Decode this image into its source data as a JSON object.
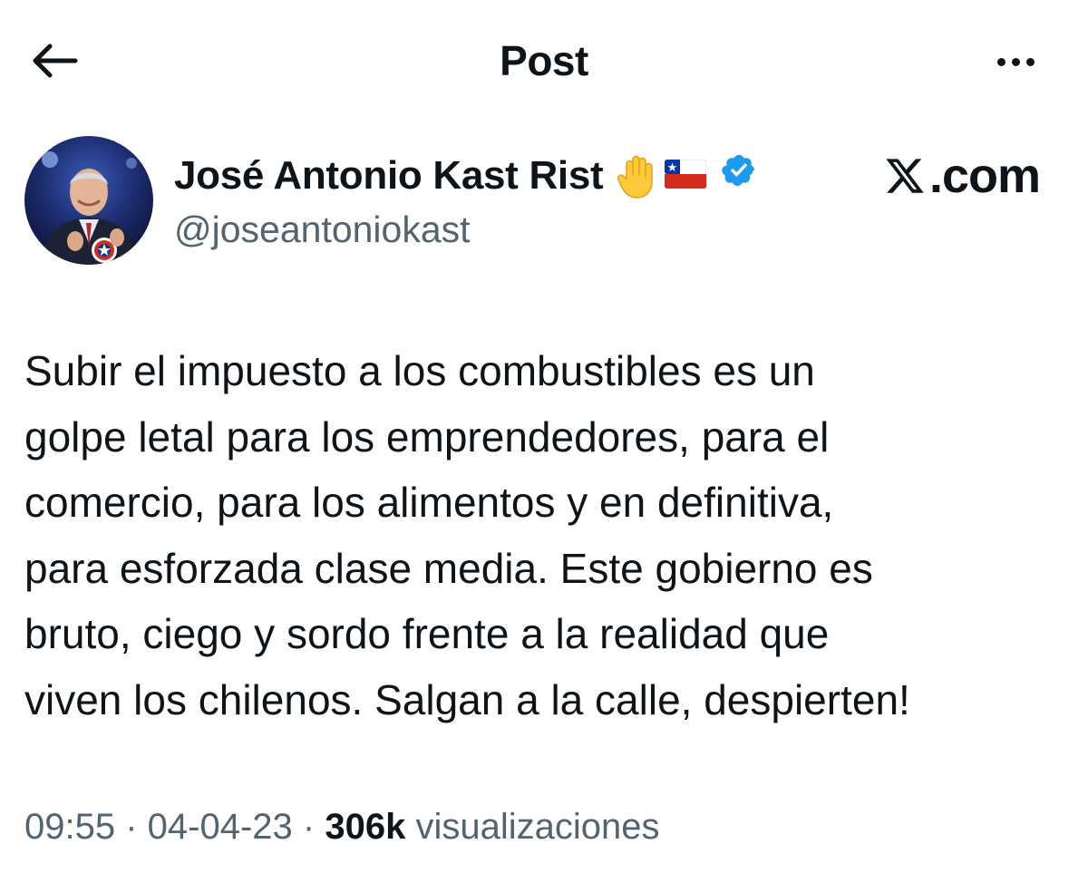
{
  "header": {
    "title": "Post",
    "back_icon": "arrow-left-icon",
    "more_icon": "more-horizontal-icon"
  },
  "author": {
    "display_name": "José Antonio Kast Rist",
    "name_emojis": [
      "raised-hand-icon",
      "chile-flag-icon"
    ],
    "verified_icon": "verified-badge-icon",
    "verified_color": "#1d9bf0",
    "handle": "@joseantoniokast",
    "avatar_icon": "avatar"
  },
  "source_watermark": {
    "text": ".com",
    "logo_icon": "x-logo-icon"
  },
  "post": {
    "text": "Subir el impuesto a los combustibles es un\ngolpe letal para los emprendedores, para el\ncomercio, para los alimentos y en definitiva,\npara esforzada clase media. Este gobierno es\nbruto, ciego y sordo frente a la realidad que\nviven los chilenos. Salgan a la calle, despierten!"
  },
  "meta": {
    "time": "09:55",
    "separator": " · ",
    "date": "04-04-23",
    "views_count": "306k",
    "views_label": "visualizaciones"
  },
  "colors": {
    "text_primary": "#0f1419",
    "text_secondary": "#536471",
    "accent": "#1d9bf0"
  }
}
